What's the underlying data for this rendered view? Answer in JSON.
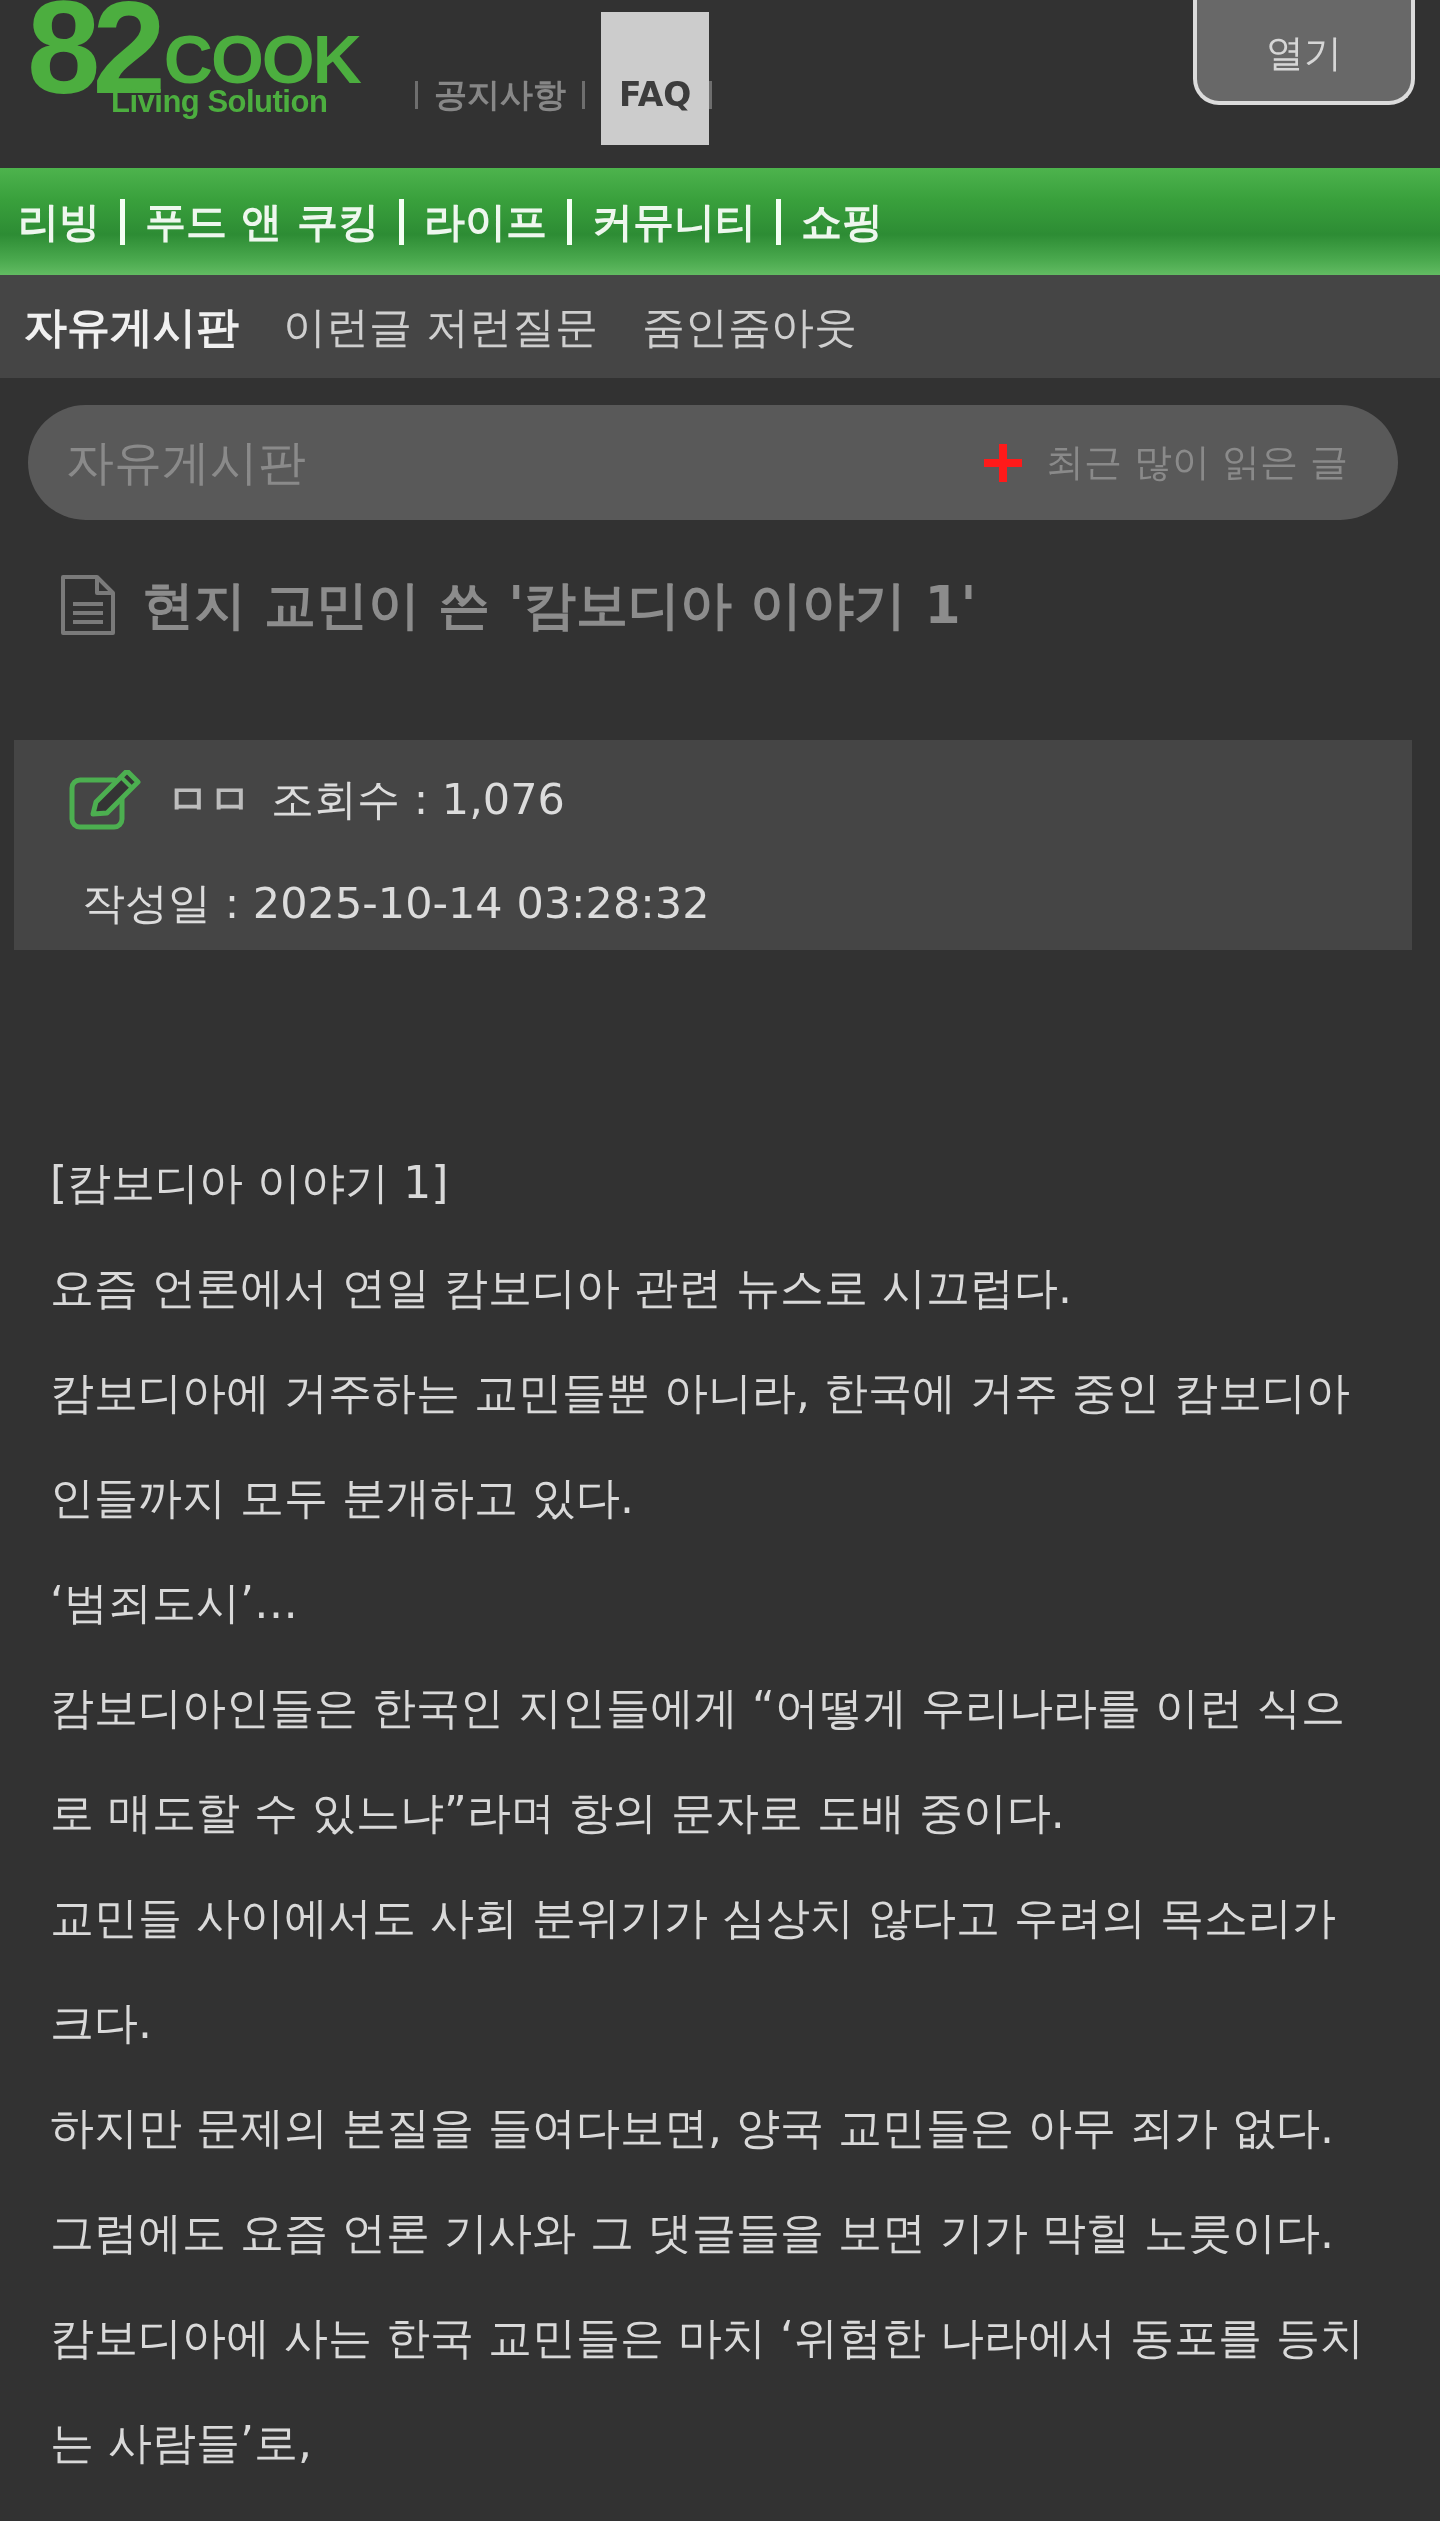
{
  "header": {
    "logo": {
      "number": "82",
      "word": "COOK",
      "tagline": "Living Solution"
    },
    "links": [
      {
        "label": "공지사항",
        "highlighted": false
      },
      {
        "label": "FAQ",
        "highlighted": true
      }
    ],
    "login_button": {
      "label": "열기"
    }
  },
  "main_nav": [
    {
      "label": "리빙"
    },
    {
      "label": "푸드 앤 쿠킹"
    },
    {
      "label": "라이프"
    },
    {
      "label": "커뮤니티"
    },
    {
      "label": "쇼핑"
    }
  ],
  "sub_nav": [
    {
      "label": "자유게시판",
      "selected": true
    },
    {
      "label": "이런글 저런질문",
      "selected": false
    },
    {
      "label": "줌인줌아웃",
      "selected": false
    }
  ],
  "board_bar": {
    "title": "자유게시판",
    "popular_link": "최근 많이 읽은 글"
  },
  "post": {
    "title": "현지 교민이 쓴 '캄보디아 이야기 1'",
    "author": "ㅁㅁ",
    "views": "조회수 : 1,076",
    "date": "작성일 : 2025-10-14 03:28:32",
    "paragraphs": [
      "[캄보디아 이야기 1]",
      "요즘 언론에서 연일 캄보디아 관련 뉴스로 시끄럽다.",
      "캄보디아에 거주하는 교민들뿐 아니라, 한국에 거주 중인 캄보디아인들까지 모두 분개하고 있다.",
      "‘범죄도시’…",
      "캄보디아인들은 한국인 지인들에게 “어떻게 우리나라를 이런 식으로 매도할 수 있느냐”라며 항의 문자로 도배 중이다.",
      "교민들 사이에서도 사회 분위기가 심상치 않다고 우려의 목소리가 크다.",
      "하지만 문제의 본질을 들여다보면, 양국 교민들은 아무 죄가 없다.",
      "그럼에도 요즘 언론 기사와 그 댓글들을 보면 기가 막힐 노릇이다.",
      "캄보디아에 사는 한국 교민들은 마치 ‘위험한 나라에서 동포를 등치는 사람들’로,"
    ]
  }
}
